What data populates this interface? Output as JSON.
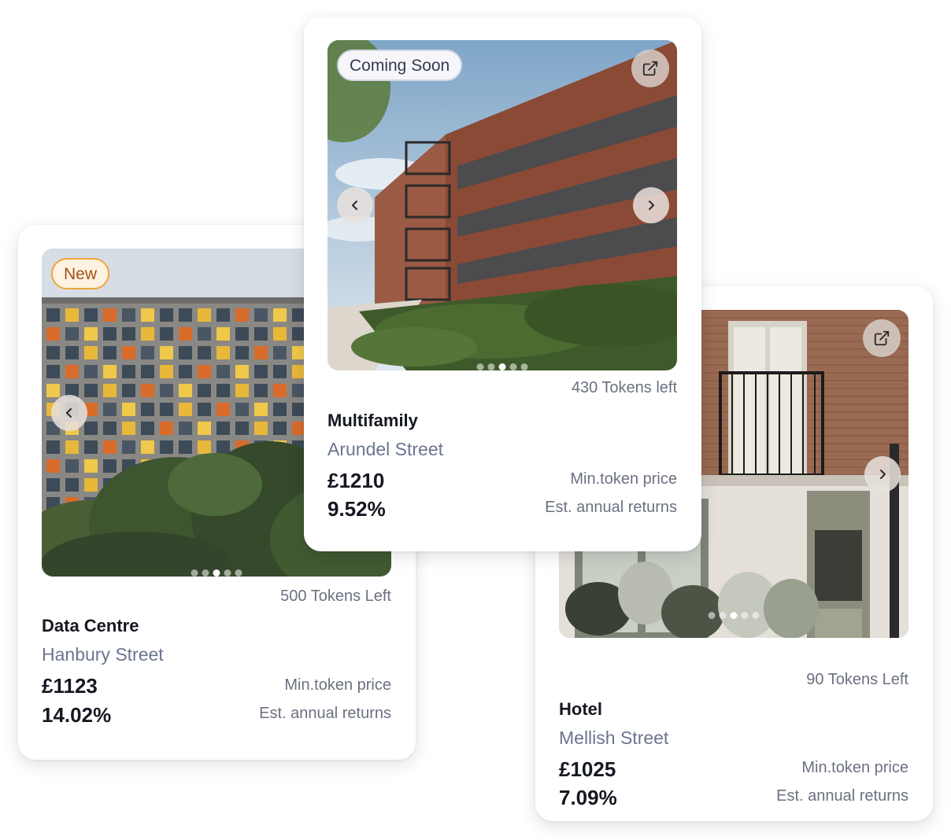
{
  "cards": [
    {
      "id": "datacentre",
      "badge": "New",
      "tokens_left": "500 Tokens Left",
      "property_type": "Data Centre",
      "street": "Hanbury Street",
      "min_token_price": "£1123",
      "min_token_price_label": "Min.token price",
      "annual_return": "14.02%",
      "annual_return_label": "Est. annual returns",
      "carousel_dots": 5,
      "active_dot": 3
    },
    {
      "id": "multifamily",
      "badge": "Coming Soon",
      "tokens_left": "430 Tokens left",
      "property_type": "Multifamily",
      "street": "Arundel Street",
      "min_token_price": "£1210",
      "min_token_price_label": "Min.token price",
      "annual_return": "9.52%",
      "annual_return_label": "Est. annual returns",
      "carousel_dots": 5,
      "active_dot": 3
    },
    {
      "id": "hotel",
      "tokens_left": "90 Tokens Left",
      "property_type": "Hotel",
      "street": "Mellish Street",
      "min_token_price": "£1025",
      "min_token_price_label": "Min.token price",
      "annual_return": "7.09%",
      "annual_return_label": "Est. annual returns",
      "carousel_dots": 5,
      "active_dot": 3
    }
  ],
  "icons": {
    "prev": "chevron-left-icon",
    "next": "chevron-right-icon",
    "external": "external-link-icon"
  },
  "colors": {
    "new_badge_border": "#f0a63a",
    "new_badge_text": "#a0521a",
    "muted_text": "#6b7180",
    "street_text": "#6b7590"
  }
}
